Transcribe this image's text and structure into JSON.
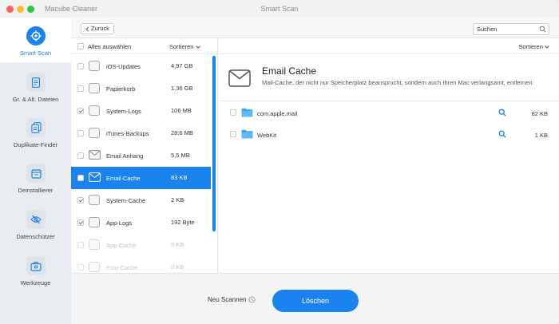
{
  "window": {
    "app_title": "Macube Cleaner",
    "title": "Smart Scan"
  },
  "sidebar": {
    "items": [
      {
        "label": "Smart Scan",
        "icon": "target-icon",
        "active": true
      },
      {
        "label": "Gr. & Alt. Dateien",
        "icon": "document-icon"
      },
      {
        "label": "Duplikate-Finder",
        "icon": "duplicate-icon"
      },
      {
        "label": "Deinstallierer",
        "icon": "uninstall-icon"
      },
      {
        "label": "Datenschützer",
        "icon": "eye-slash-icon"
      },
      {
        "label": "Werkzeuge",
        "icon": "toolbox-icon"
      }
    ]
  },
  "toolbar": {
    "back_label": "Zurück",
    "search_placeholder": "Suchen"
  },
  "list": {
    "select_all_label": "Alles auswählen",
    "sort_label": "Sortieren",
    "items": [
      {
        "name": "iOS-Updates",
        "size": "4,97 GB",
        "checked": false
      },
      {
        "name": "Papierkorb",
        "size": "1,36 GB",
        "checked": false
      },
      {
        "name": "System-Logs",
        "size": "106 MB",
        "checked": true
      },
      {
        "name": "iTunes-Backups",
        "size": "28,6 MB",
        "checked": false
      },
      {
        "name": "Email Anhang",
        "size": "5,5 MB",
        "checked": false
      },
      {
        "name": "Email Cache",
        "size": "83 KB",
        "checked": false,
        "active": true
      },
      {
        "name": "System-Cache",
        "size": "2 KB",
        "checked": true
      },
      {
        "name": "App-Logs",
        "size": "192 Byte",
        "checked": true
      },
      {
        "name": "App-Cache",
        "size": "0 KB",
        "checked": false,
        "disabled": true
      },
      {
        "name": "Foto-Cache",
        "size": "0 KB",
        "checked": false,
        "disabled": true
      }
    ]
  },
  "detail": {
    "sort_label": "Sortieren",
    "title": "Email Cache",
    "description": "Mail-Cache, der nicht nur Speicherplatz beansprucht, sondern auch Ihren Mac verlangsamt, entfernen",
    "files": [
      {
        "name": "com.apple.mail",
        "size": "82 KB"
      },
      {
        "name": "WebKit",
        "size": "1 KB"
      }
    ]
  },
  "footer": {
    "rescan_label": "Neu Scannen",
    "delete_label": "Löschen"
  },
  "colors": {
    "accent": "#1a83ef",
    "sidebar_bg": "#e9ecf1",
    "folder": "#3aa6f5"
  }
}
